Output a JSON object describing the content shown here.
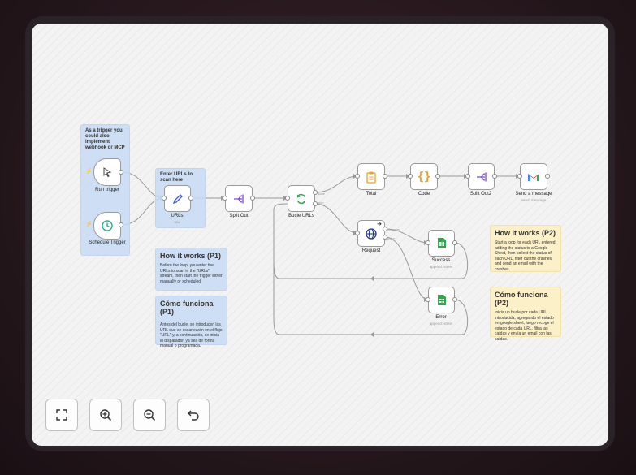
{
  "stickies": {
    "trigger_note": "As a trigger you could also implement webhook or MCP",
    "enter_urls": "Enter URLs to scan here",
    "p1_en_title": "How it works (P1)",
    "p1_en_body": "Before the loop, you enter the URLs to scan in the \"URLs\" stream, then start the trigger either manually or scheduled.",
    "p1_es_title": "Cómo funciona (P1)",
    "p1_es_body": "Antes del bucle, se introducen las URL que se escanearán en el flujo \"URL\" y, a continuación, se inicia el disparador, ya sea de forma manual o programada.",
    "p2_en_title": "How it works (P2)",
    "p2_en_body": "Start a loop for each URL entered, adding the status to a Google Sheet, then collect the status of each URL, filter out the crashes, and send an email with the crashes.",
    "p2_es_title": "Cómo funciona (P2)",
    "p2_es_body": "Inicia un bucle por cada URL introducida, agregando el estado en google sheet, luego recoge el estado de cada URL, filtra las caídas y envía un email con las caídas."
  },
  "nodes": {
    "run_trigger": "Run trigger",
    "schedule_trigger": "Schedule Trigger",
    "urls": "URLs",
    "urls_sub": "raw",
    "split_out": "Split Out",
    "bucle_urls": "Bucle URLs",
    "bucle_done": "done",
    "bucle_loop": "loop",
    "total": "Total",
    "code": "Code",
    "split_out2": "Split Out2",
    "send_message": "Send a message",
    "send_message_sub": "send: message",
    "request": "Request",
    "request_success": "Success",
    "request_error": "Error",
    "success": "Success",
    "success_sub": "append: sheet",
    "error": "Error",
    "error_sub": "append: sheet"
  },
  "controls": {
    "fit": "fit-view",
    "zoom_in": "zoom-in",
    "zoom_out": "zoom-out",
    "undo": "undo"
  },
  "colors": {
    "sticky_blue": "#c7dbf4",
    "sticky_yellow": "#fbf0c8",
    "purple": "#7b4bd8",
    "green": "#2aa84a",
    "orange": "#f0a020",
    "navy": "#1f3a8a"
  }
}
